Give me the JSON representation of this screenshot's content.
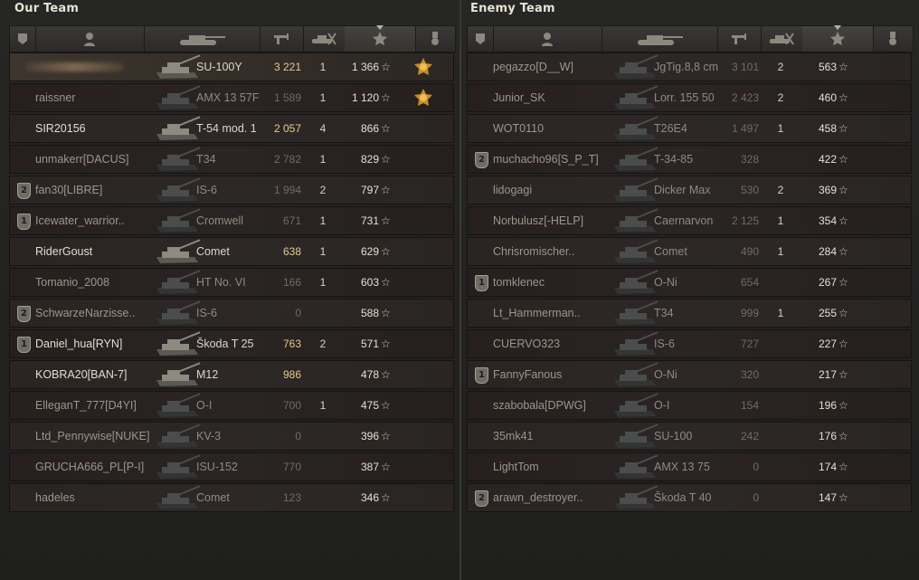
{
  "teams": [
    {
      "id": "left",
      "title": "Our Team",
      "players": [
        {
          "badge": "",
          "name": "",
          "blurred": true,
          "tank": "SU-100Y",
          "damage": "3 221",
          "kills": "1",
          "xp": "1 366",
          "medal": true,
          "alive": true,
          "highlight": true
        },
        {
          "badge": "",
          "name": "raissner",
          "tank": "AMX 13 57F",
          "damage": "1 589",
          "kills": "1",
          "xp": "1 120",
          "medal": true,
          "alive": false
        },
        {
          "badge": "",
          "name": "SIR20156",
          "tank": "T-54 mod. 1",
          "damage": "2 057",
          "kills": "4",
          "xp": "866",
          "medal": false,
          "alive": true
        },
        {
          "badge": "",
          "name": "unmakerr[DACUS]",
          "tank": "T34",
          "damage": "2 782",
          "kills": "1",
          "xp": "829",
          "medal": false,
          "alive": false
        },
        {
          "badge": "2",
          "name": "fan30[LIBRE]",
          "tank": "IS-6",
          "damage": "1 994",
          "kills": "2",
          "xp": "797",
          "medal": false,
          "alive": false
        },
        {
          "badge": "1",
          "name": "Icewater_warrior..",
          "tank": "Cromwell",
          "damage": "671",
          "kills": "1",
          "xp": "731",
          "medal": false,
          "alive": false
        },
        {
          "badge": "",
          "name": "RiderGoust",
          "tank": "Comet",
          "damage": "638",
          "kills": "1",
          "xp": "629",
          "medal": false,
          "alive": true
        },
        {
          "badge": "",
          "name": "Tomanio_2008",
          "tank": "HT No. VI",
          "damage": "166",
          "kills": "1",
          "xp": "603",
          "medal": false,
          "alive": false
        },
        {
          "badge": "2",
          "name": "SchwarzeNarzisse..",
          "tank": "IS-6",
          "damage": "0",
          "kills": "",
          "xp": "588",
          "medal": false,
          "alive": false
        },
        {
          "badge": "1",
          "name": "Daniel_hua[RYN]",
          "tank": "Škoda T 25",
          "damage": "763",
          "kills": "2",
          "xp": "571",
          "medal": false,
          "alive": true
        },
        {
          "badge": "",
          "name": "KOBRA20[BAN-7]",
          "tank": "M12",
          "damage": "986",
          "kills": "",
          "xp": "478",
          "medal": false,
          "alive": true
        },
        {
          "badge": "",
          "name": "ElleganT_777[D4YI]",
          "tank": "O-I",
          "damage": "700",
          "kills": "1",
          "xp": "475",
          "medal": false,
          "alive": false
        },
        {
          "badge": "",
          "name": "Ltd_Pennywise[NUKE]",
          "tank": "KV-3",
          "damage": "0",
          "kills": "",
          "xp": "396",
          "medal": false,
          "alive": false
        },
        {
          "badge": "",
          "name": "GRUCHA666_PL[P-I]",
          "tank": "ISU-152",
          "damage": "770",
          "kills": "",
          "xp": "387",
          "medal": false,
          "alive": false
        },
        {
          "badge": "",
          "name": "hadeles",
          "tank": "Comet",
          "damage": "123",
          "kills": "",
          "xp": "346",
          "medal": false,
          "alive": false
        }
      ]
    },
    {
      "id": "right",
      "title": "Enemy Team",
      "players": [
        {
          "badge": "",
          "name": "pegazzo[D__W]",
          "tank": "JgTig.8,8 cm",
          "damage": "3 101",
          "kills": "2",
          "xp": "563",
          "medal": false,
          "alive": false
        },
        {
          "badge": "",
          "name": "Junior_SK",
          "tank": "Lorr. 155 50",
          "damage": "2 423",
          "kills": "2",
          "xp": "460",
          "medal": false,
          "alive": false
        },
        {
          "badge": "",
          "name": "WOT0110",
          "tank": "T26E4",
          "damage": "1 497",
          "kills": "1",
          "xp": "458",
          "medal": false,
          "alive": false
        },
        {
          "badge": "2",
          "name": "muchacho96[S_P_T]",
          "tank": "T-34-85",
          "damage": "328",
          "kills": "",
          "xp": "422",
          "medal": false,
          "alive": false
        },
        {
          "badge": "",
          "name": "lidogagi",
          "tank": "Dicker Max",
          "damage": "530",
          "kills": "2",
          "xp": "369",
          "medal": false,
          "alive": false
        },
        {
          "badge": "",
          "name": "Norbulusz[-HELP]",
          "tank": "Caernarvon",
          "damage": "2 125",
          "kills": "1",
          "xp": "354",
          "medal": false,
          "alive": false
        },
        {
          "badge": "",
          "name": "Chrisromischer..",
          "tank": "Comet",
          "damage": "490",
          "kills": "1",
          "xp": "284",
          "medal": false,
          "alive": false
        },
        {
          "badge": "1",
          "name": "tomklenec",
          "tank": "O-Ni",
          "damage": "654",
          "kills": "",
          "xp": "267",
          "medal": false,
          "alive": false
        },
        {
          "badge": "",
          "name": "Lt_Hammerman..",
          "tank": "T34",
          "damage": "999",
          "kills": "1",
          "xp": "255",
          "medal": false,
          "alive": false
        },
        {
          "badge": "",
          "name": "CUERVO323",
          "tank": "IS-6",
          "damage": "727",
          "kills": "",
          "xp": "227",
          "medal": false,
          "alive": false
        },
        {
          "badge": "1",
          "name": "FannyFanous",
          "tank": "O-Ni",
          "damage": "320",
          "kills": "",
          "xp": "217",
          "medal": false,
          "alive": false
        },
        {
          "badge": "",
          "name": "szabobala[DPWG]",
          "tank": "O-I",
          "damage": "154",
          "kills": "",
          "xp": "196",
          "medal": false,
          "alive": false
        },
        {
          "badge": "",
          "name": "35mk41",
          "tank": "SU-100",
          "damage": "242",
          "kills": "",
          "xp": "176",
          "medal": false,
          "alive": false
        },
        {
          "badge": "",
          "name": "LightTom",
          "tank": "AMX 13 75",
          "damage": "0",
          "kills": "",
          "xp": "174",
          "medal": false,
          "alive": false
        },
        {
          "badge": "2",
          "name": "arawn_destroyer..",
          "tank": "Škoda T 40",
          "damage": "0",
          "kills": "",
          "xp": "147",
          "medal": false,
          "alive": false
        }
      ]
    }
  ],
  "columns": [
    "squad-icon",
    "player-icon",
    "tank-icon",
    "damage-icon",
    "kills-icon",
    "xp-star-icon",
    "medal-icon"
  ],
  "sorted_column": "xp-star-icon",
  "star_glyph": "☆"
}
